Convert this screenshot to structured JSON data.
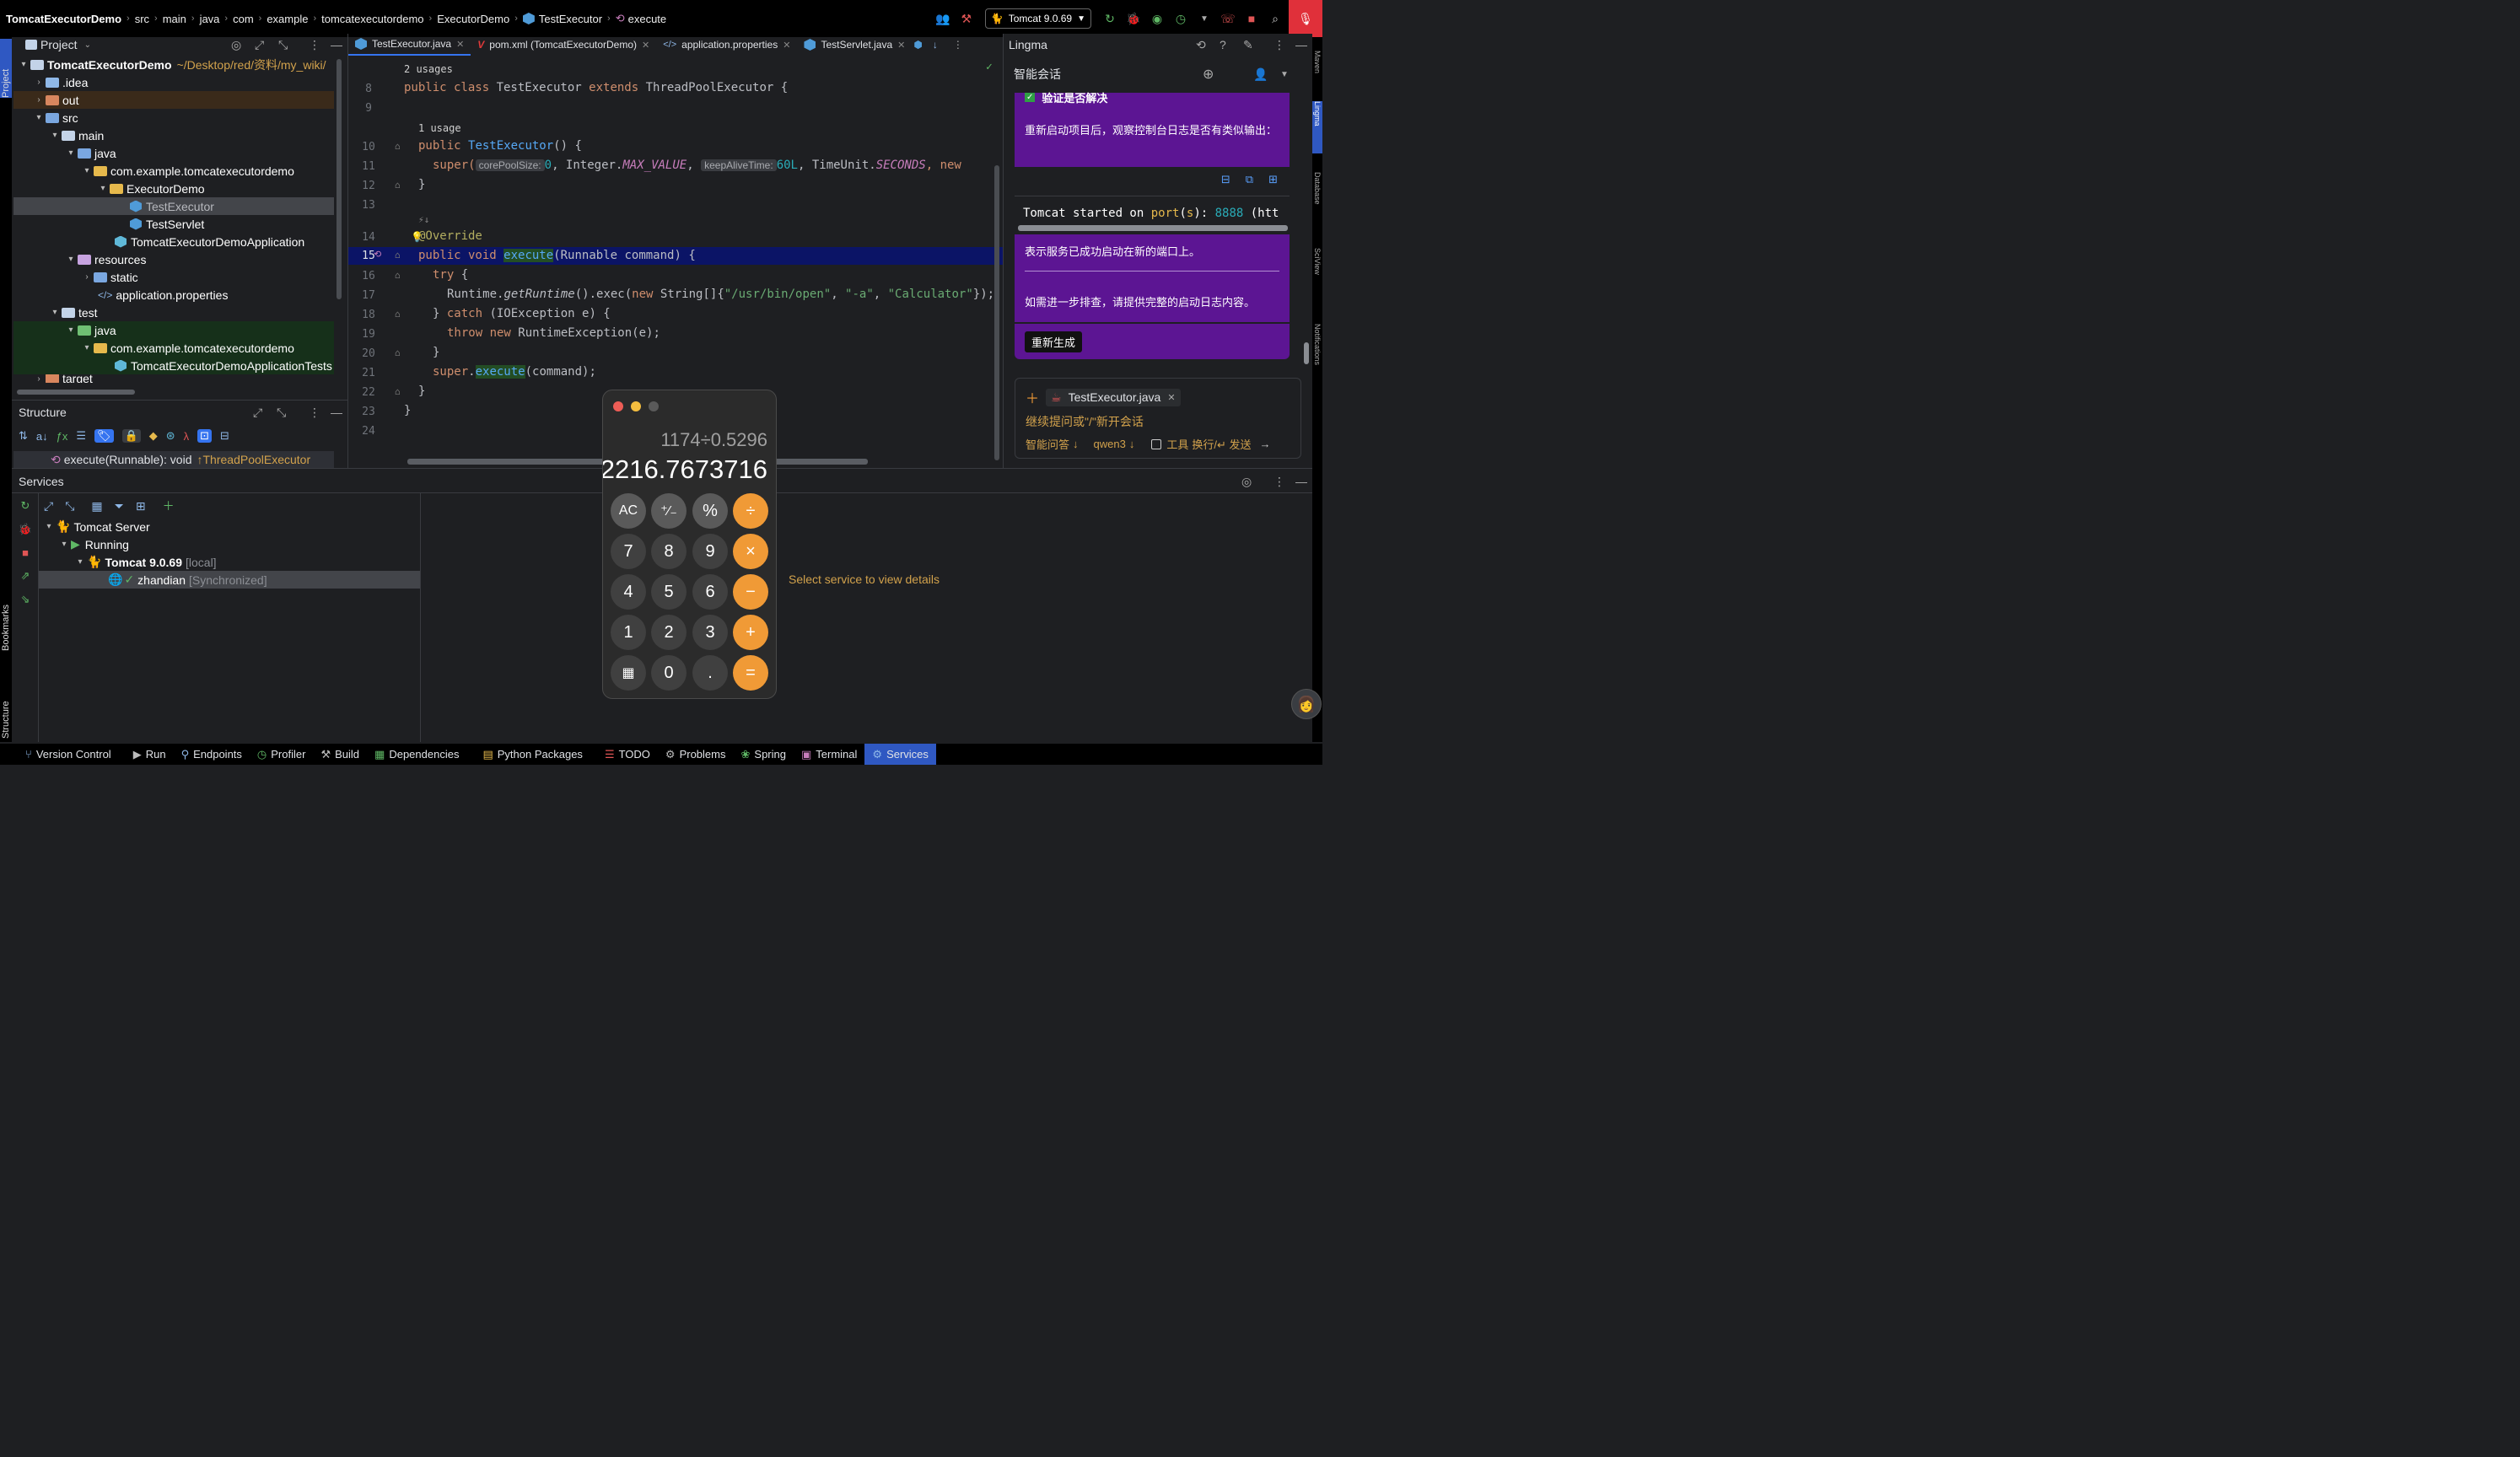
{
  "breadcrumb": {
    "items": [
      "TomcatExecutorDemo",
      "src",
      "main",
      "java",
      "com",
      "example",
      "tomcatexecutordemo",
      "ExecutorDemo",
      "TestExecutor",
      "execute"
    ]
  },
  "toolbar": {
    "run_config": "Tomcat 9.0.69"
  },
  "left_stripe": {
    "project": "Project",
    "bookmarks": "Bookmarks",
    "structure": "Structure"
  },
  "right_stripe": {
    "maven": "Maven",
    "lingma": "Lingma",
    "database": "Database",
    "sciview": "SciView",
    "notifications": "Notifications"
  },
  "project": {
    "title": "Project",
    "root_name": "TomcatExecutorDemo",
    "root_path": "~/Desktop/red/资料/my_wiki/",
    "items": [
      {
        "label": "TomcatExecutorDemo"
      },
      {
        "label": ".idea"
      },
      {
        "label": "out"
      },
      {
        "label": "src"
      },
      {
        "label": "main"
      },
      {
        "label": "java"
      },
      {
        "label": "com.example.tomcatexecutordemo"
      },
      {
        "label": "ExecutorDemo"
      },
      {
        "label": "TestExecutor"
      },
      {
        "label": "TestServlet"
      },
      {
        "label": "TomcatExecutorDemoApplication"
      },
      {
        "label": "resources"
      },
      {
        "label": "static"
      },
      {
        "label": "application.properties"
      },
      {
        "label": "test"
      },
      {
        "label": "java"
      },
      {
        "label": "com.example.tomcatexecutordemo"
      },
      {
        "label": "TomcatExecutorDemoApplicationTests"
      },
      {
        "label": "target"
      }
    ]
  },
  "structure": {
    "title": "Structure",
    "method": "execute(Runnable): void",
    "inherited": "↑ThreadPoolExecutor"
  },
  "editor": {
    "tabs": [
      {
        "label": "TestExecutor.java"
      },
      {
        "label": "pom.xml (TomcatExecutorDemo)"
      },
      {
        "label": "application.properties"
      },
      {
        "label": "TestServlet.java"
      }
    ],
    "usages_class": "2 usages",
    "usages_ctor": "1 usage",
    "line_numbers": [
      "8",
      "9",
      "10",
      "11",
      "12",
      "13",
      "14",
      "15",
      "16",
      "17",
      "18",
      "19",
      "20",
      "21",
      "22",
      "23",
      "24"
    ],
    "code": {
      "l8_a": "public class ",
      "l8_b": "TestExecutor",
      "l8_c": " extends ",
      "l8_d": "ThreadPoolExecutor {",
      "l10_a": "public ",
      "l10_b": "TestExecutor",
      "l10_c": "() {",
      "l11_a": "super(",
      "l11_hint1": "corePoolSize:",
      "l11_b": "0",
      "l11_c": ", Integer.",
      "l11_d": "MAX_VALUE",
      "l11_e": ",",
      "l11_hint2": "keepAliveTime:",
      "l11_f": "60L",
      "l11_g": ", TimeUnit.",
      "l11_h": "SECONDS",
      "l11_i": ", new",
      "l12": "}",
      "l14": "@Override",
      "l15_a": "public void ",
      "l15_b": "execute",
      "l15_c": "(Runnable command) {",
      "l16_a": "try",
      "l16_b": " {",
      "l17_a": "Runtime.",
      "l17_b": "getRuntime",
      "l17_c": "().exec(",
      "l17_d": "new ",
      "l17_e": "String[]{",
      "l17_f": "\"/usr/bin/open\"",
      "l17_g": ", ",
      "l17_h": "\"-a\"",
      "l17_i": ", ",
      "l17_j": "\"Calculator\"",
      "l17_k": "});",
      "l18_a": "} ",
      "l18_b": "catch",
      "l18_c": " (IOException e) {",
      "l19_a": "throw new ",
      "l19_b": "RuntimeException(e);",
      "l20": "}",
      "l21_a": "super",
      "l21_b": ".",
      "l21_c": "execute",
      "l21_d": "(command);",
      "l22": "}",
      "l23": "}"
    }
  },
  "lingma": {
    "title": "Lingma",
    "session_title": "智能会话",
    "verify_heading": "验证是否解决",
    "restart_text": "重新启动项目后，观察控制台日志是否有类似输出：",
    "console_a": "Tomcat started on ",
    "console_b": "port",
    "console_c": "(",
    "console_d": "s",
    "console_e": "): ",
    "console_f": "8888",
    "console_g": " (htt",
    "success_text": "表示服务已成功启动在新的端口上。",
    "more_text": "如需进一步排查，请提供完整的启动日志内容。",
    "regenerate": "重新生成",
    "file_chip": "TestExecutor.java",
    "input_placeholder": "继续提问或\"/\"新开会话",
    "mode": "智能问答",
    "model": "qwen3",
    "tools": "工具",
    "send_hint": "换行/↵ 发送"
  },
  "services": {
    "title": "Services",
    "tree": [
      {
        "label": "Tomcat Server"
      },
      {
        "label": "Running"
      },
      {
        "label": "Tomcat 9.0.69",
        "suffix": "[local]"
      },
      {
        "label": "zhandian",
        "suffix": "[Synchronized]"
      }
    ],
    "placeholder": "Select service to view details"
  },
  "calculator": {
    "expression": "1174÷0.5296",
    "result": "2216.7673716",
    "buttons": [
      "AC",
      "⁺∕₋",
      "%",
      "÷",
      "7",
      "8",
      "9",
      "×",
      "4",
      "5",
      "6",
      "−",
      "1",
      "2",
      "3",
      "+",
      "▦",
      "0",
      ".",
      "="
    ]
  },
  "statusbar": {
    "items": [
      {
        "label": "Version Control"
      },
      {
        "label": "Run"
      },
      {
        "label": "Endpoints"
      },
      {
        "label": "Profiler"
      },
      {
        "label": "Build"
      },
      {
        "label": "Dependencies"
      },
      {
        "label": "Python Packages"
      },
      {
        "label": "TODO"
      },
      {
        "label": "Problems"
      },
      {
        "label": "Spring"
      },
      {
        "label": "Terminal"
      },
      {
        "label": "Services"
      }
    ]
  },
  "colors": {
    "accent": "#3574f0",
    "lingma_bubble": "#5c1593",
    "calculator_operator": "#f09a36",
    "current_line": "#0b1466"
  }
}
